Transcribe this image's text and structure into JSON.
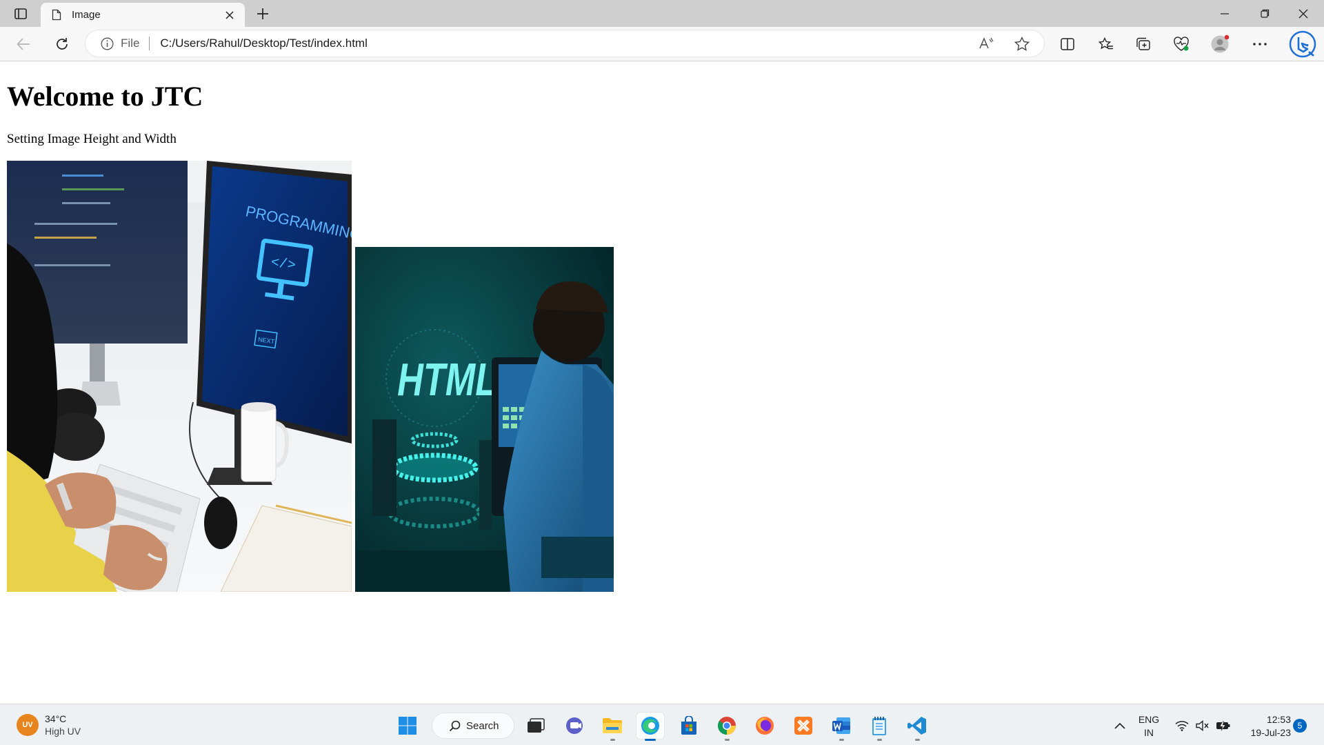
{
  "browser": {
    "tab_title": "Image",
    "address_scheme": "File",
    "address_url": "C:/Users/Rahul/Desktop/Test/index.html"
  },
  "page": {
    "heading": "Welcome to JTC",
    "paragraph": "Setting Image Height and Width",
    "images": [
      {
        "name": "programming-photo",
        "overlay_text": "PROGRAMMING",
        "button_text": "NEXT"
      },
      {
        "name": "html-photo",
        "overlay_text": "HTML"
      }
    ]
  },
  "taskbar": {
    "weather_badge": "UV",
    "temperature": "34°C",
    "condition": "High UV",
    "search_label": "Search",
    "language_top": "ENG",
    "language_bottom": "IN",
    "time": "12:53",
    "date": "19-Jul-23",
    "notification_count": "5"
  },
  "colors": {
    "accent": "#0067c0",
    "weather_badge": "#e8841d"
  }
}
